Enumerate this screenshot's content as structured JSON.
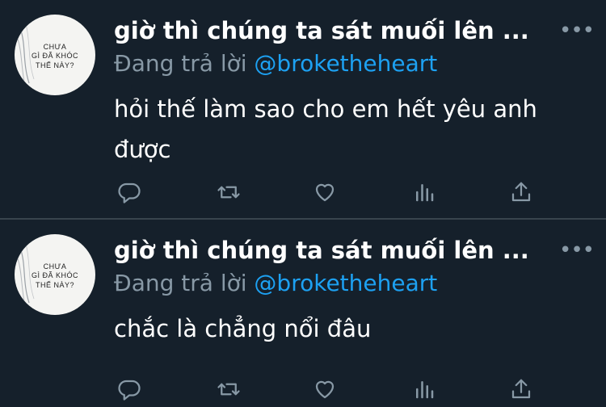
{
  "tweets": [
    {
      "author_name": "giờ thì chúng ta sát muối lên ...",
      "reply_prefix": "Đang trả lời",
      "reply_handle": "@broketheheart",
      "text": "hỏi thế làm sao cho em hết yêu anh được",
      "avatar_caption": [
        "CHƯA",
        "GÌ ĐÃ KHÓC",
        "THẾ NÀY?"
      ]
    },
    {
      "author_name": "giờ thì chúng ta sát muối lên ...",
      "reply_prefix": "Đang trả lời",
      "reply_handle": "@broketheheart",
      "text": "chắc là chẳng nổi đâu",
      "avatar_caption": [
        "CHƯA",
        "GÌ ĐÃ KHÓC",
        "THẾ NÀY?"
      ]
    }
  ],
  "more_icon": "more-dots-icon",
  "actions": [
    "reply-icon",
    "retweet-icon",
    "like-icon",
    "stats-icon",
    "share-icon"
  ],
  "colors": {
    "background": "#15202b",
    "divider": "#38444d",
    "secondary_text": "#8899a6",
    "link": "#1da1f2",
    "primary_text": "#ffffff"
  }
}
